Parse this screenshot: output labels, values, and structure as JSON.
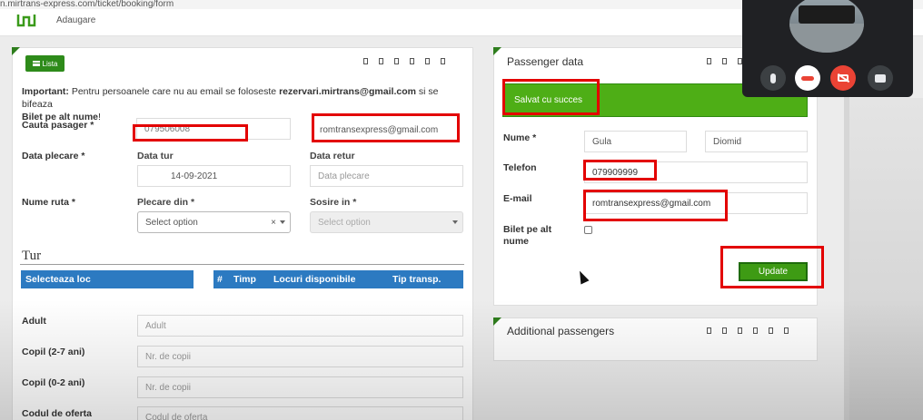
{
  "browser": {
    "url": "n.mirtrans-express.com/ticket/booking/form"
  },
  "topnav": {
    "link": "Adaugare"
  },
  "left_panel": {
    "lista_button": "Lista",
    "notice_strong": "Important:",
    "notice_text": " Pentru persoanele care nu au email se foloseste ",
    "notice_email": "rezervari.mirtrans@gmail.com",
    "notice_text2": " si se bifeaza",
    "notice_strong2": "Bilet pe alt nume",
    "notice_end": "!",
    "cauta_label": "Cauta pasager *",
    "cauta_phone": "079506008",
    "cauta_email": "romtransexpress@gmail.com",
    "data_plecare_label": "Data plecare *",
    "data_tur_label": "Data tur",
    "data_tur_value": "14-09-2021",
    "data_retur_label": "Data retur",
    "data_retur_placeholder": "Data plecare",
    "nume_ruta_label": "Nume ruta *",
    "plecare_din_label": "Plecare din *",
    "plecare_placeholder": "Select option",
    "plecare_clear": "×",
    "sosire_label": "Sosire in *",
    "sosire_placeholder": "Select option",
    "tur_title": "Tur",
    "selecteaza_loc": "Selecteaza loc",
    "table_headers": [
      "#",
      "Timp",
      "Locuri disponibile",
      "Tip transp."
    ],
    "adult_label": "Adult",
    "adult_placeholder": "Adult",
    "copil1_label": "Copil (2-7 ani)",
    "copil1_placeholder": "Nr. de copii",
    "copil2_label": "Copil (0-2 ani)",
    "copil2_placeholder": "Nr. de copii",
    "cod_label": "Codul de oferta",
    "cod_placeholder": "Codul de oferta"
  },
  "passenger_panel": {
    "title": "Passenger data",
    "success_msg": "Salvat cu succes",
    "nume_label": "Nume *",
    "first_name": "Gula",
    "last_name": "Diomid",
    "telefon_label": "Telefon",
    "telefon_value": "079909999",
    "email_label": "E-mail",
    "email_value": "romtransexpress@gmail.com",
    "bilet_label": "Bilet pe alt nume",
    "update_button": "Update"
  },
  "additional_panel": {
    "title": "Additional passengers"
  },
  "colors": {
    "accent_green": "#2e8b1a",
    "success_green": "#4eae16",
    "table_blue": "#2c7ac1",
    "highlight_red": "#e30000"
  },
  "video_call": {
    "icons": [
      "mic-icon",
      "end-call-icon",
      "camera-off-icon",
      "present-icon"
    ]
  }
}
